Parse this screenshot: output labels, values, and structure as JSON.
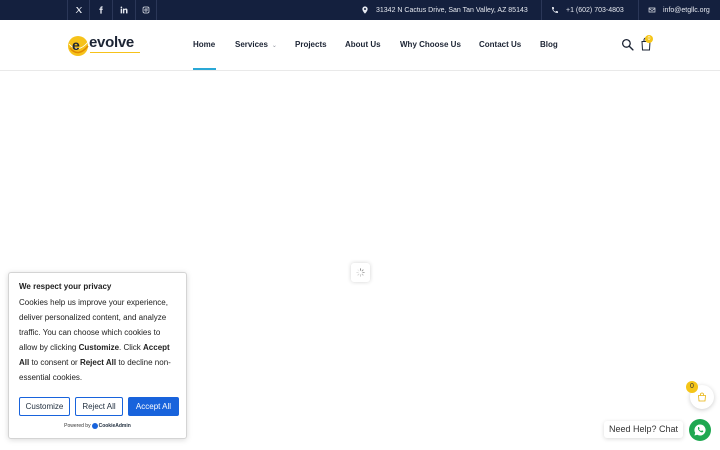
{
  "topbar": {
    "social": [
      {
        "name": "x-icon"
      },
      {
        "name": "facebook-icon"
      },
      {
        "name": "linkedin-icon"
      },
      {
        "name": "instagram-icon"
      }
    ],
    "address": "31342 N Cactus Drive, San Tan Valley, AZ 85143",
    "phone": "+1 (602) 703-4803",
    "email": "info@etgllc.org"
  },
  "header": {
    "logo_text": "evolve",
    "nav": [
      {
        "label": "Home",
        "active": true
      },
      {
        "label": "Services",
        "has_dropdown": true
      },
      {
        "label": "Projects"
      },
      {
        "label": "About Us"
      },
      {
        "label": "Why Choose Us"
      },
      {
        "label": "Contact Us"
      },
      {
        "label": "Blog"
      }
    ],
    "cart_count": "0"
  },
  "cookie": {
    "title": "We respect your privacy",
    "text_1": "Cookies help us improve your experience, deliver personalized content, and analyze traffic. You can choose which cookies to allow by clicking ",
    "bold_customize": "Customize",
    "text_2": ". Click ",
    "bold_accept": "Accept All",
    "text_3": " to consent or ",
    "bold_reject": "Reject All",
    "text_4": " to decline non-essential cookies.",
    "buttons": {
      "customize": "Customize",
      "reject": "Reject All",
      "accept": "Accept All"
    },
    "powered_by": "Powered by",
    "powered_brand": "CookieAdmin"
  },
  "floating_cart": {
    "count": "0"
  },
  "chat": {
    "label": "Need Help? Chat"
  },
  "colors": {
    "topbar_bg": "#14203e",
    "accent": "#2aa8d6",
    "cookie_button": "#1863dc",
    "whatsapp": "#1fa851",
    "badge": "#f5c518"
  }
}
